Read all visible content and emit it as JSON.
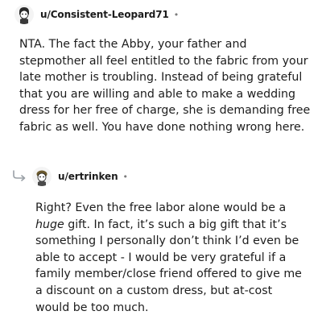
{
  "comments": [
    {
      "username": "u/Consistent-Leopard71",
      "separator": "•",
      "body": "NTA. The fact the Abby, your father and stepmother all feel entitled to the fabric from your late mother is troubling. Instead of being grateful that you are willing and able to make a wedding dress for her free of charge, she is demanding free fabric as well. You have done nothing wrong here."
    },
    {
      "username": "u/ertrinken",
      "separator": "•",
      "body_pre": "Right? Even the free labor alone would be a ",
      "body_em": "huge",
      "body_post": " gift. In fact, it’s such a big gift that it’s something I personally don’t think I’d even be able to accept - I would be very grateful if a family member/close friend offered to give me a discount on a custom dress, but at-cost would be too much."
    }
  ]
}
